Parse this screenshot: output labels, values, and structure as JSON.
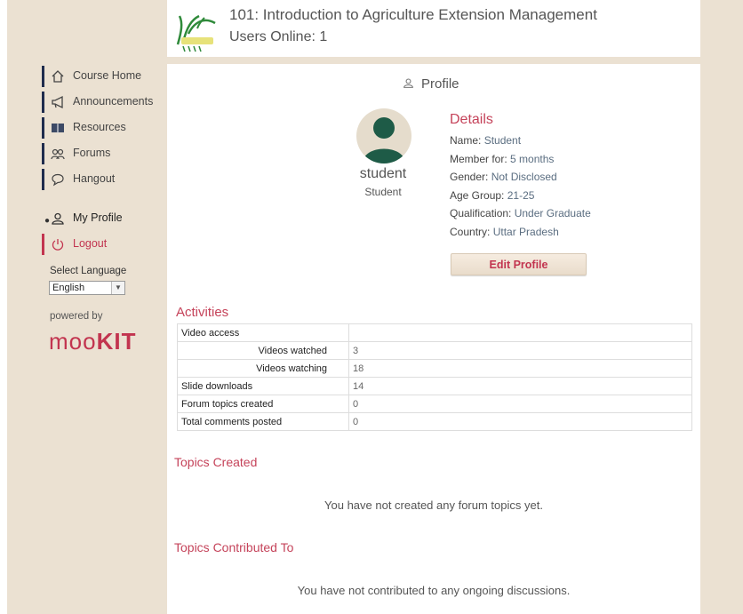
{
  "header": {
    "course_title": "101: Introduction to Agriculture Extension Management",
    "users_online": "Users Online: 1",
    "logo_icon": "institute-logo"
  },
  "sidebar": {
    "items": [
      {
        "label": "Course Home",
        "icon": "home-icon"
      },
      {
        "label": "Announcements",
        "icon": "megaphone-icon"
      },
      {
        "label": "Resources",
        "icon": "book-icon"
      },
      {
        "label": "Forums",
        "icon": "users-icon"
      },
      {
        "label": "Hangout",
        "icon": "chat-icon"
      },
      {
        "label": "My Profile",
        "icon": "user-icon"
      },
      {
        "label": "Logout",
        "icon": "power-icon"
      }
    ],
    "language_label": "Select Language",
    "language_value": "English",
    "powered_by": "powered by",
    "brand": "mooKIT"
  },
  "profile": {
    "heading": "Profile",
    "username": "student",
    "role": "Student",
    "details_heading": "Details",
    "details": [
      {
        "label": "Name:",
        "value": "Student"
      },
      {
        "label": "Member for:",
        "value": "5 months"
      },
      {
        "label": "Gender:",
        "value": "Not Disclosed"
      },
      {
        "label": "Age Group:",
        "value": "21-25"
      },
      {
        "label": "Qualification:",
        "value": "Under Graduate"
      },
      {
        "label": "Country:",
        "value": "Uttar Pradesh"
      }
    ],
    "edit_button": "Edit Profile"
  },
  "activities": {
    "heading": "Activities",
    "rows": [
      {
        "label": "Video access",
        "value": ""
      },
      {
        "label": "Videos watched",
        "value": "3"
      },
      {
        "label": "Videos watching",
        "value": "18"
      },
      {
        "label": "Slide downloads",
        "value": "14"
      },
      {
        "label": "Forum topics created",
        "value": "0"
      },
      {
        "label": "Total comments posted",
        "value": "0"
      }
    ]
  },
  "topics_created": {
    "heading": "Topics Created",
    "message": "You have not created any forum topics yet."
  },
  "topics_contributed": {
    "heading": "Topics Contributed To",
    "message": "You have not contributed to any ongoing discussions."
  },
  "colors": {
    "frame": "#ebe1d2",
    "accent": "#c5435a",
    "nav_bar": "#1f2c4d",
    "logout_bar": "#c2344f",
    "avatar": "#1e5b47"
  }
}
